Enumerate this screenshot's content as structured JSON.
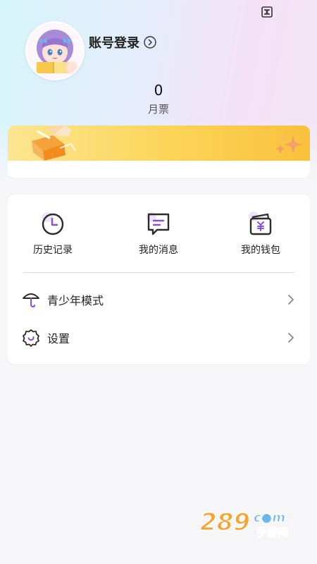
{
  "header": {
    "login_label": "账号登录",
    "monthly_ticket_count": "0",
    "monthly_ticket_label": "月票"
  },
  "quick_actions": [
    {
      "label": "历史记录",
      "icon": "history-clock-icon"
    },
    {
      "label": "我的消息",
      "icon": "message-icon"
    },
    {
      "label": "我的钱包",
      "icon": "wallet-icon"
    }
  ],
  "menu": [
    {
      "label": "青少年模式",
      "icon": "umbrella-icon"
    },
    {
      "label": "设置",
      "icon": "gear-icon"
    }
  ],
  "watermark": {
    "main": "289",
    "suffix": "c●m",
    "sub": "手游网"
  },
  "colors": {
    "accent_purple": "#8a4fd6",
    "banner_yellow": "#fcd457",
    "header_gradient_start": "#d6f5fb",
    "header_gradient_end": "#f4e1f6"
  }
}
